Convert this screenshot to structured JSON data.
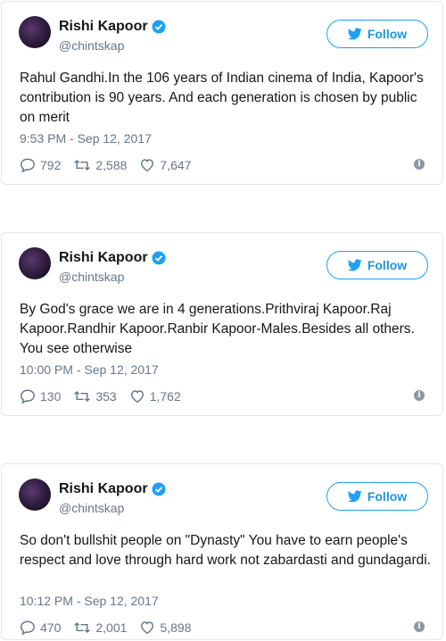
{
  "tweets": [
    {
      "name": "Rishi Kapoor",
      "handle": "@chintskap",
      "follow_label": "Follow",
      "text": "Rahul Gandhi.In the 106 years of Indian cinema of India, Kapoor's contribution is 90 years. And each generation is chosen by public on merit",
      "time": "9:53 PM - Sep 12, 2017",
      "replies": "792",
      "retweets": "2,588",
      "likes": "7,647"
    },
    {
      "name": "Rishi Kapoor",
      "handle": "@chintskap",
      "follow_label": "Follow",
      "text": "By God's grace we are in 4 generations.Prithviraj Kapoor.Raj Kapoor.Randhir Kapoor.Ranbir Kapoor-Males.Besides all others. You see otherwise",
      "time": "10:00 PM - Sep 12, 2017",
      "replies": "130",
      "retweets": "353",
      "likes": "1,762"
    },
    {
      "name": "Rishi Kapoor",
      "handle": "@chintskap",
      "follow_label": "Follow",
      "text": "So don't bullshit people on \"Dynasty\" You have to earn people's respect and love through hard work not zabardasti and gundagardi.",
      "time": "10:12 PM - Sep 12, 2017",
      "replies": "470",
      "retweets": "2,001",
      "likes": "5,898"
    }
  ],
  "colors": {
    "accent": "#1da1f2",
    "muted": "#657786",
    "border": "#e1e8ed"
  },
  "icons": {
    "verified": "verified-badge-icon",
    "bird": "twitter-bird-icon",
    "reply": "reply-icon",
    "retweet": "retweet-icon",
    "like": "heart-icon",
    "info": "info-icon"
  }
}
